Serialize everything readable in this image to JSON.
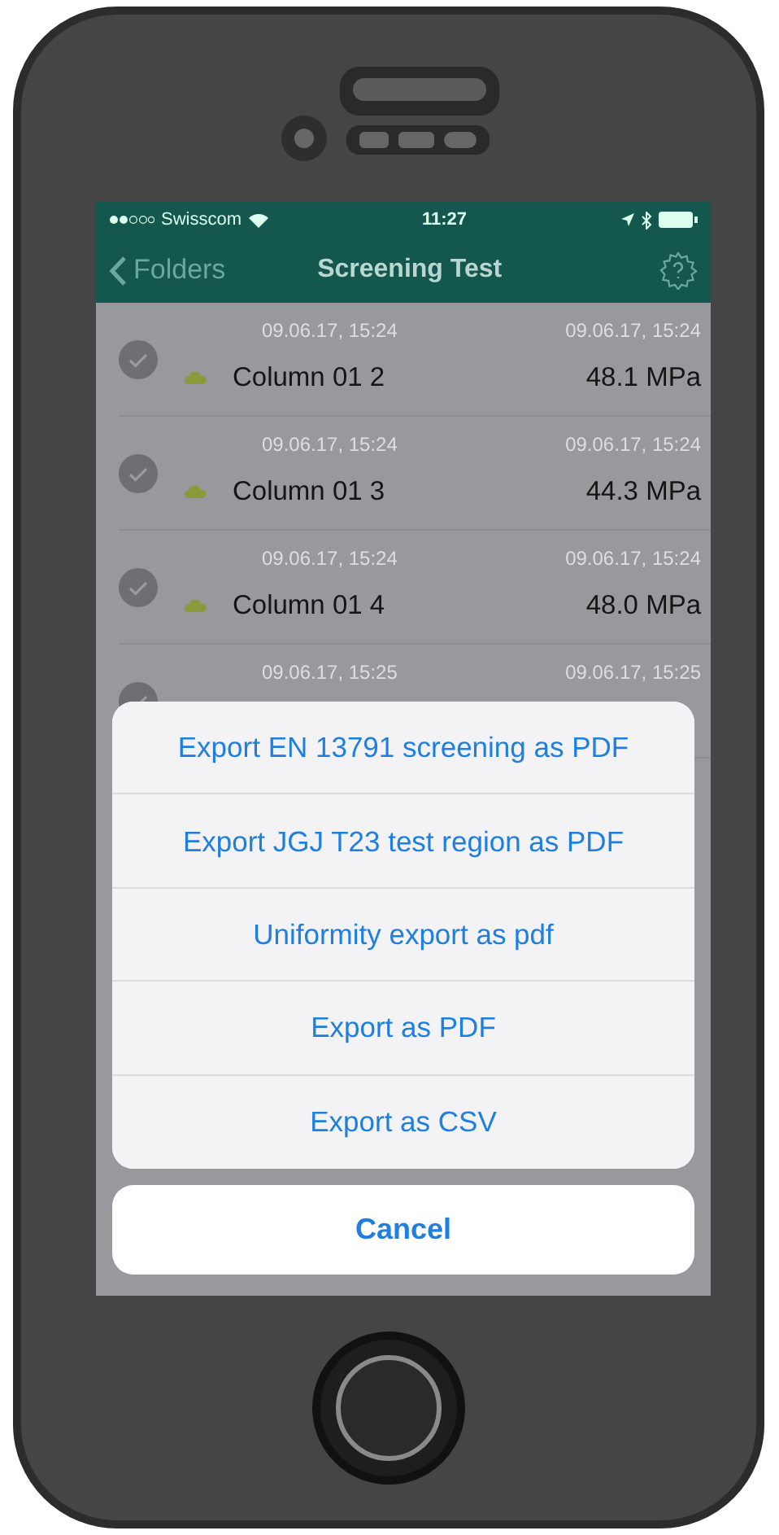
{
  "status_bar": {
    "carrier": "Swisscom",
    "time": "11:27"
  },
  "nav": {
    "back": "Folders",
    "title": "Screening Test"
  },
  "rows": [
    {
      "date_left": "09.06.17, 15:24",
      "date_right": "09.06.17, 15:24",
      "name": "Column 01 2",
      "value": "48.1 MPa",
      "checked": true
    },
    {
      "date_left": "09.06.17, 15:24",
      "date_right": "09.06.17, 15:24",
      "name": "Column 01 3",
      "value": "44.3 MPa",
      "checked": true
    },
    {
      "date_left": "09.06.17, 15:24",
      "date_right": "09.06.17, 15:24",
      "name": "Column 01 4",
      "value": "48.0 MPa",
      "checked": true
    },
    {
      "date_left": "09.06.17, 15:25",
      "date_right": "09.06.17, 15:25",
      "checked": true
    }
  ],
  "action_sheet": {
    "actions": [
      "Export EN 13791 screening as PDF",
      "Export JGJ T23 test region as PDF",
      "Uniformity export as pdf",
      "Export as PDF",
      "Export as CSV"
    ],
    "cancel": "Cancel"
  }
}
